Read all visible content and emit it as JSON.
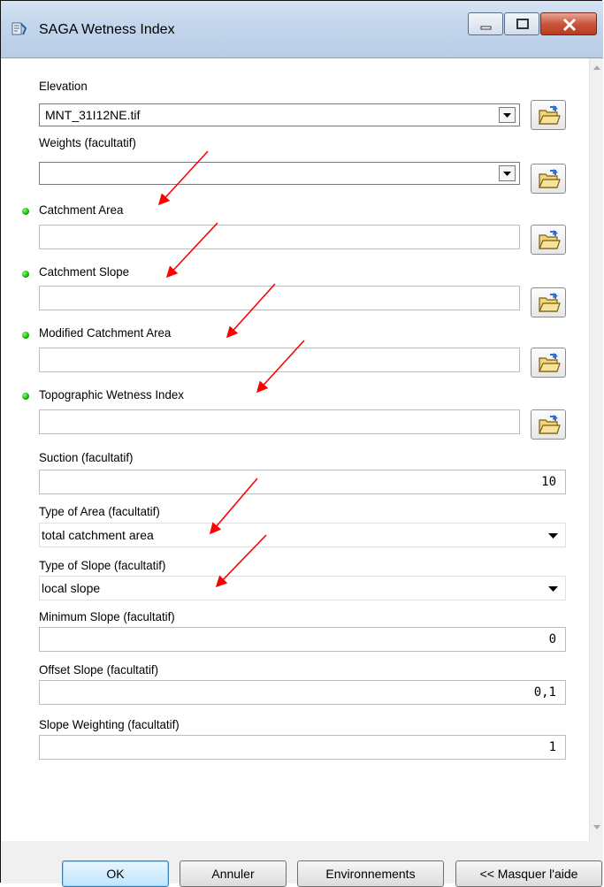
{
  "window": {
    "title": "SAGA Wetness Index",
    "icon": "saga-tool-icon",
    "controls": [
      "minimize-icon",
      "maximize-icon",
      "close-icon"
    ]
  },
  "fields": {
    "elevation": {
      "label": "Elevation",
      "value": "MNT_31I12NE.tif"
    },
    "weights": {
      "label": "Weights (facultatif)",
      "value": ""
    },
    "catchment_area": {
      "label": "Catchment Area",
      "value": ""
    },
    "catchment_slope": {
      "label": "Catchment Slope",
      "value": ""
    },
    "modified_catchment_area": {
      "label": "Modified Catchment Area",
      "value": ""
    },
    "topographic_wetness_index": {
      "label": "Topographic Wetness Index",
      "value": ""
    },
    "suction": {
      "label": "Suction (facultatif)",
      "value": "10"
    },
    "type_of_area": {
      "label": "Type of Area (facultatif)",
      "value": "total catchment area"
    },
    "type_of_slope": {
      "label": "Type of Slope (facultatif)",
      "value": "local slope"
    },
    "minimum_slope": {
      "label": "Minimum Slope (facultatif)",
      "value": "0"
    },
    "offset_slope": {
      "label": "Offset Slope (facultatif)",
      "value": "0,1"
    },
    "slope_weighting": {
      "label": "Slope Weighting (facultatif)",
      "value": "1"
    }
  },
  "buttons": {
    "ok": "OK",
    "cancel": "Annuler",
    "environments": "Environnements",
    "hide_help": "<< Masquer l'aide"
  },
  "colors": {
    "required_dot": "#0aa300",
    "annotation_arrow": "#ff0000",
    "titlebar": "#c3d6ec"
  }
}
